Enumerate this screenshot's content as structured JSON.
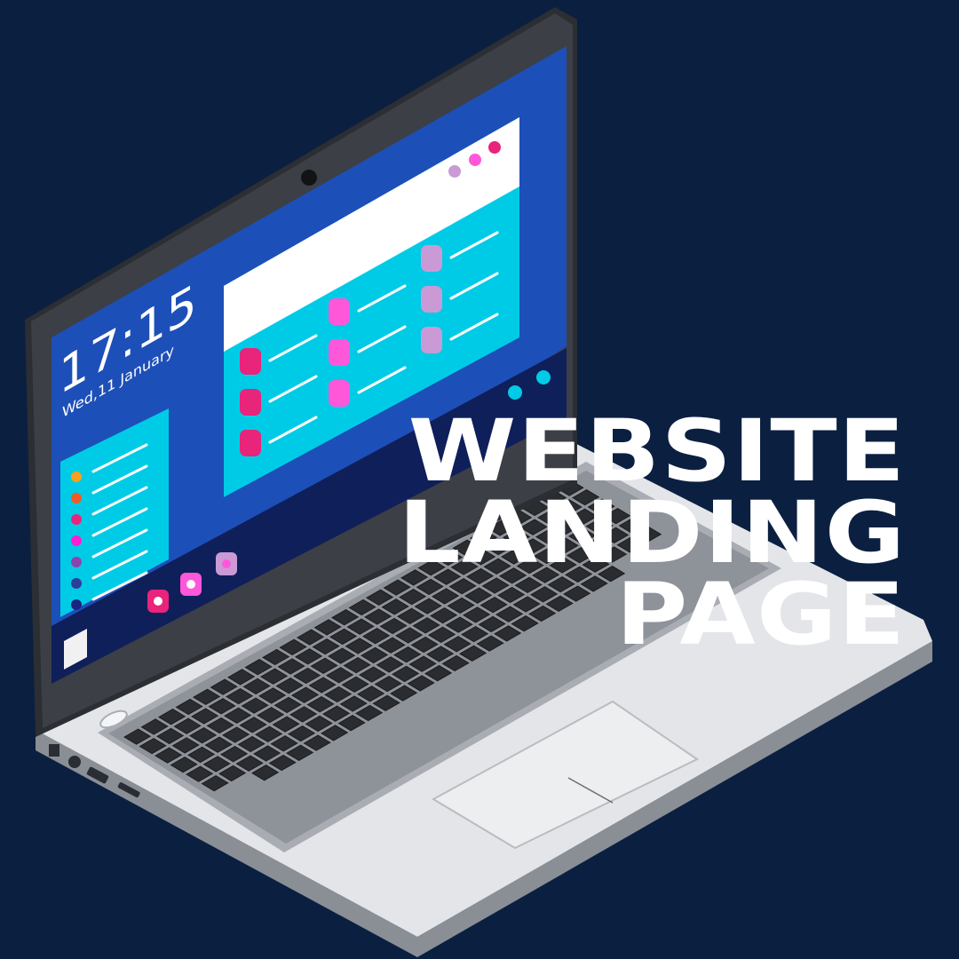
{
  "screen": {
    "clock_time": "17:15",
    "clock_date": "Wed,11 January"
  },
  "headline": {
    "line1": "WEBSITE",
    "line2": "LANDING",
    "line3": "PAGE"
  },
  "colors": {
    "background": "#0b1f41",
    "screen_blue": "#1d4fb8",
    "panel_cyan": "#00cbe6",
    "accent_magenta": "#e8247b",
    "accent_pink": "#ff57d9",
    "accent_lilac": "#c99ad6"
  },
  "icons": [
    "webcam-icon",
    "start-icon",
    "app-icon",
    "window-control-dot-icon"
  ]
}
